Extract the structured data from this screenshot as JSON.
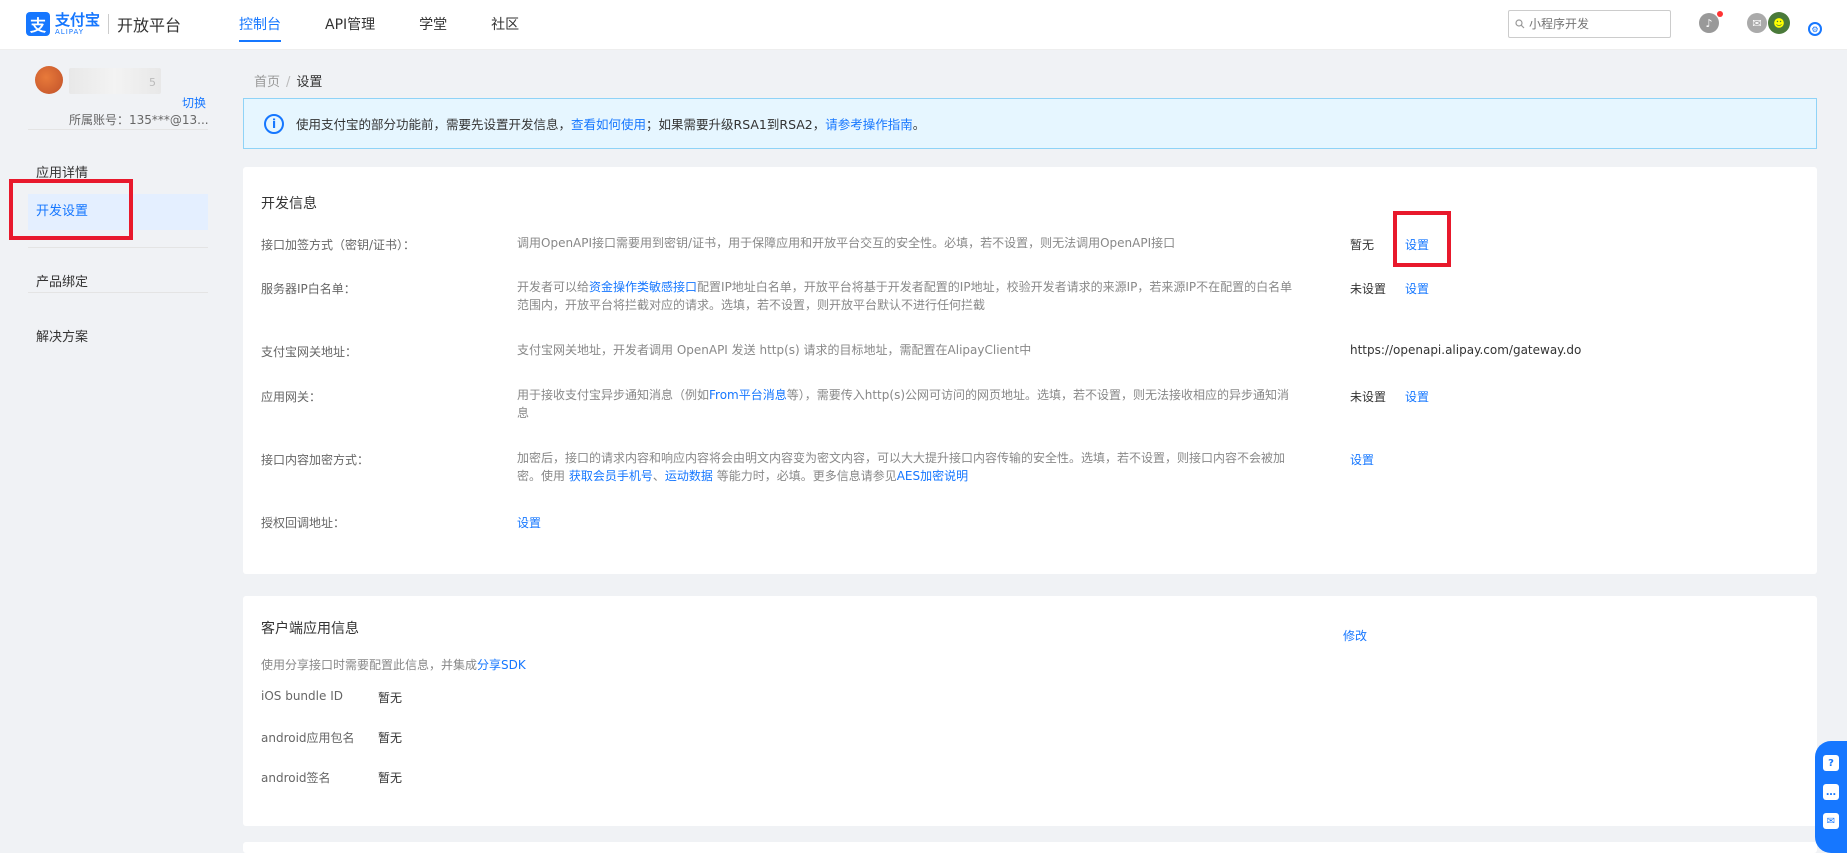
{
  "header": {
    "logo_cn": "支付宝",
    "logo_en": "ALIPAY",
    "platform": "开放平台",
    "nav": [
      "控制台",
      "API管理",
      "学堂",
      "社区"
    ],
    "search_placeholder": "小程序开发"
  },
  "sidebar": {
    "app_name_suffix": "5",
    "switch_label": "切换",
    "account": "所属账号：135***@13...",
    "items": [
      "应用详情",
      "开发设置",
      "产品绑定",
      "解决方案"
    ]
  },
  "breadcrumb": {
    "home": "首页",
    "sep": "/",
    "current": "设置"
  },
  "notice": {
    "part1": "使用支付宝的部分功能前，需要先设置开发信息，",
    "link1": "查看如何使用",
    "part2": "；如果需要升级RSA1到RSA2，",
    "link2": "请参考操作指南",
    "part3": "。"
  },
  "dev_info": {
    "title": "开发信息",
    "rows": [
      {
        "label": "接口加签方式（密钥/证书）：",
        "desc": "调用OpenAPI接口需要用到密钥/证书，用于保障应用和开放平台交互的安全性。必填，若不设置，则无法调用OpenAPI接口",
        "status": "暂无",
        "action": "设置"
      },
      {
        "label": "服务器IP白名单：",
        "desc_pre": "开发者可以给",
        "desc_link": "资金操作类敏感接口",
        "desc_post": "配置IP地址白名单，开放平台将基于开发者配置的IP地址，校验开发者请求的来源IP，若来源IP不在配置的白名单范围内，开放平台将拦截对应的请求。选填，若不设置，则开放平台默认不进行任何拦截",
        "status": "未设置",
        "action": "设置"
      },
      {
        "label": "支付宝网关地址：",
        "desc": "支付宝网关地址，开发者调用 OpenAPI 发送 http(s) 请求的目标地址，需配置在AlipayClient中",
        "status": "https://openapi.alipay.com/gateway.do"
      },
      {
        "label": "应用网关：",
        "desc_pre": "用于接收支付宝异步通知消息（例如",
        "desc_link": "From平台消息",
        "desc_post": "等），需要传入http(s)公网可访问的网页地址。选填，若不设置，则无法接收相应的异步通知消息",
        "status": "未设置",
        "action": "设置"
      },
      {
        "label": "接口内容加密方式：",
        "desc_pre": "加密后，接口的请求内容和响应内容将会由明文内容变为密文内容，可以大大提升接口内容传输的安全性。选填，若不设置，则接口内容不会被加密。使用 ",
        "desc_link": "获取会员手机号",
        "desc_mid": "、",
        "desc_link2": "运动数据",
        "desc_mid2": " 等能力时，必填。更多信息请参见",
        "desc_link3": "AES加密说明",
        "action": "设置"
      },
      {
        "label": "授权回调地址：",
        "action": "设置"
      }
    ]
  },
  "client_info": {
    "title": "客户端应用信息",
    "edit": "修改",
    "desc_pre": "使用分享接口时需要配置此信息，并集成",
    "desc_link": "分享SDK",
    "rows": [
      {
        "label": "iOS bundle ID",
        "value": "暂无"
      },
      {
        "label": "android应用包名",
        "value": "暂无"
      },
      {
        "label": "android签名",
        "value": "暂无"
      }
    ]
  },
  "float_icons": [
    "question-icon",
    "chat-icon",
    "feedback-icon"
  ]
}
